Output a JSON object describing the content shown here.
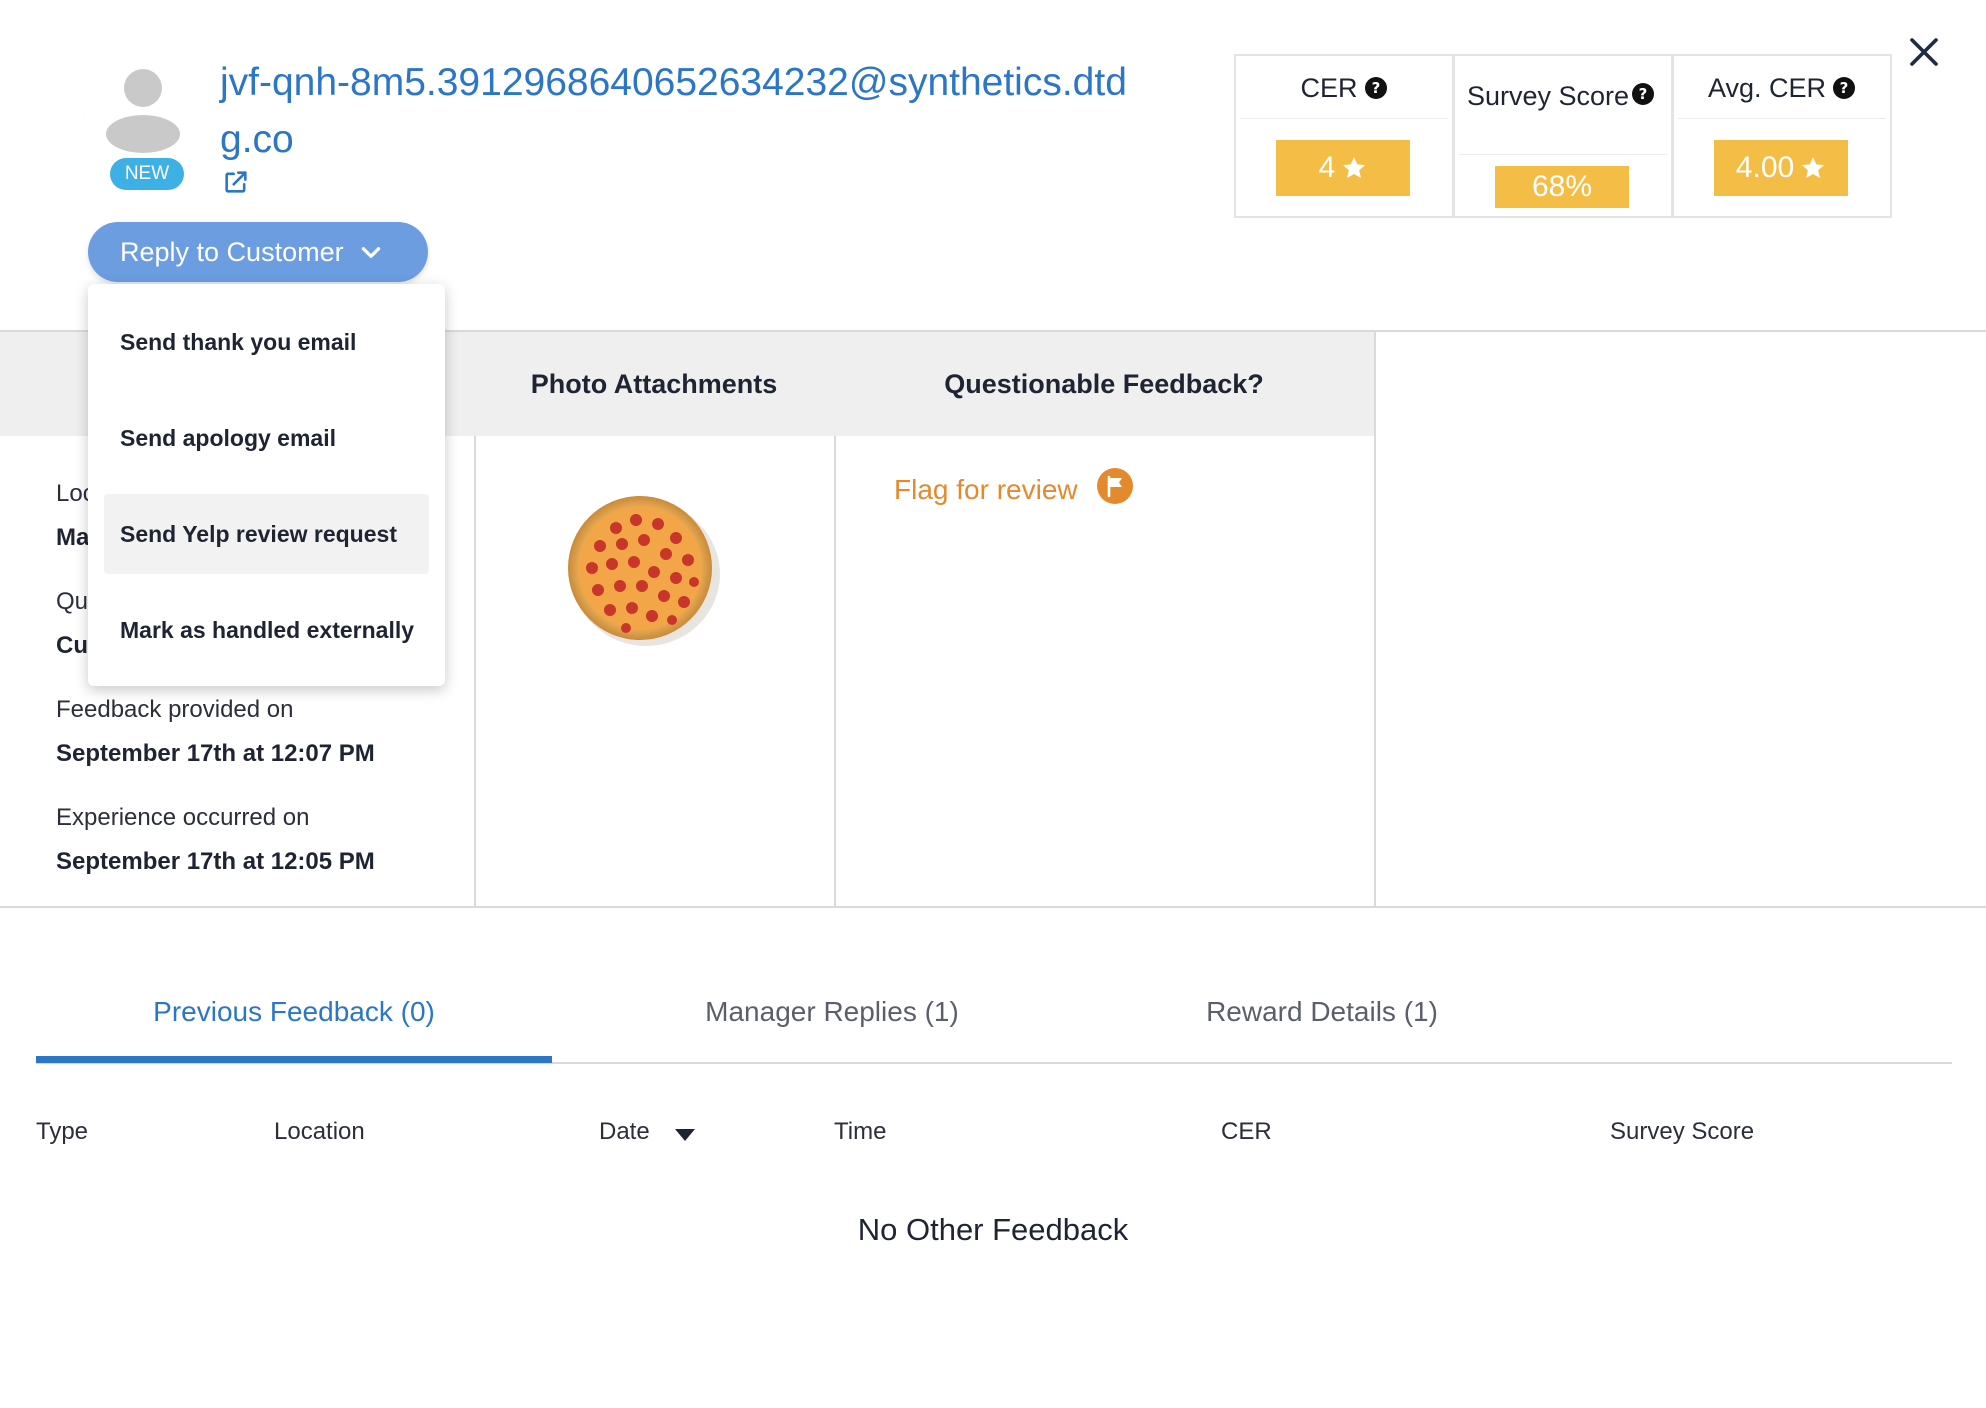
{
  "customer": {
    "email": "jvf-qnh-8m5.3912968640652634232@synthetics.dtdg.co",
    "badge": "NEW"
  },
  "reply": {
    "button_label": "Reply to Customer",
    "menu": [
      "Send thank you email",
      "Send apology email",
      "Send Yelp review request",
      "Mark as handled externally"
    ]
  },
  "metrics": {
    "cer": {
      "label": "CER",
      "value": "4"
    },
    "survey": {
      "label": "Survey Score",
      "value": "68%"
    },
    "avg_cer": {
      "label": "Avg. CER",
      "value": "4.00"
    }
  },
  "panels": {
    "details": {
      "partial": [
        "Loc",
        "Ma",
        "Que",
        "Cu"
      ],
      "feedback_label": "Feedback provided on",
      "feedback_value": "September 17th at 12:07 PM",
      "experience_label": "Experience occurred on",
      "experience_value": "September 17th at 12:05 PM"
    },
    "photos": {
      "header": "Photo Attachments"
    },
    "questionable": {
      "header": "Questionable Feedback?",
      "flag_label": "Flag for review"
    }
  },
  "tabs": [
    {
      "label": "Previous Feedback (0)",
      "active": true
    },
    {
      "label": "Manager Replies (1)",
      "active": false
    },
    {
      "label": "Reward Details (1)",
      "active": false
    }
  ],
  "table": {
    "columns": [
      "Type",
      "Location",
      "Date",
      "Time",
      "CER",
      "Survey Score"
    ],
    "empty_message": "No Other Feedback"
  },
  "colors": {
    "accent": "#2b76c7",
    "badge": "#f4bd45",
    "flag": "#e48a2e",
    "new_badge": "#3fb0e6",
    "reply_button": "#6b9de0"
  },
  "icons": [
    "avatar-icon",
    "external-link-icon",
    "chevron-down-icon",
    "help-icon",
    "star-icon",
    "close-icon",
    "flag-icon",
    "sort-down-icon"
  ]
}
